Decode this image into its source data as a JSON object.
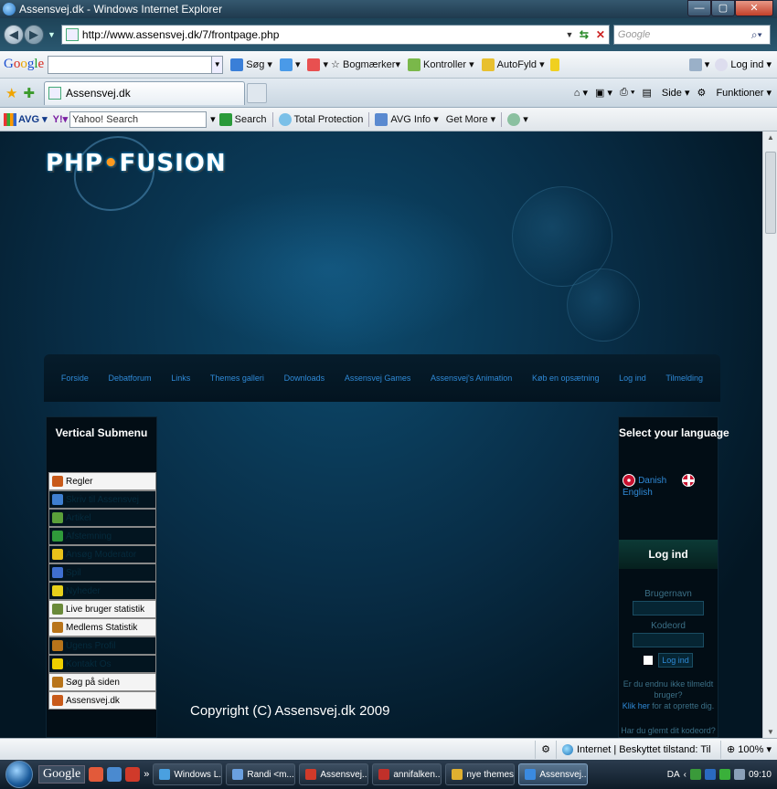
{
  "window": {
    "title": "Assensvej.dk - Windows Internet Explorer",
    "buttons": {
      "minimize": "—",
      "maximize": "▢",
      "close": "✕"
    }
  },
  "addressbar": {
    "url": "http://www.assensvej.dk/7/frontpage.php",
    "search_placeholder": "Google"
  },
  "google_toolbar": {
    "brand": "Google",
    "search_label": "Søg",
    "bookmarks_label": "Bogmærker",
    "check_label": "Kontroller",
    "autofill_label": "AutoFyld",
    "login_label": "Log ind"
  },
  "tabs": {
    "active_title": "Assensvej.dk",
    "commands": {
      "page": "Side",
      "tools": "Funktioner"
    }
  },
  "avg_toolbar": {
    "brand": "AVG",
    "yahoo_placeholder": "Yahoo! Search",
    "search_label": "Search",
    "total_protection": "Total Protection",
    "avg_info": "AVG Info",
    "get_more": "Get More"
  },
  "page": {
    "logo_text_1": "PHP",
    "logo_text_2": "FUSION",
    "nav": [
      "Forside",
      "Debatforum",
      "Links",
      "Themes galleri",
      "Downloads",
      "Assensvej Games",
      "Assensvej's Animation",
      "Køb en opsætning",
      "Log ind",
      "Tilmelding"
    ],
    "left_panel": {
      "title": "Vertical Submenu",
      "items": [
        {
          "label": "Regler",
          "style": "light",
          "icon_color": "#c85a1a"
        },
        {
          "label": "Skriv til Assensvej",
          "style": "dark",
          "icon_color": "#3f7fd0"
        },
        {
          "label": "Artikel",
          "style": "dark",
          "icon_color": "#5aa03a"
        },
        {
          "label": "Afstemning",
          "style": "dark",
          "icon_color": "#2f9a3a"
        },
        {
          "label": "Ansøg Moderator",
          "style": "dark",
          "icon_color": "#e8c21a"
        },
        {
          "label": "Spil",
          "style": "dark",
          "icon_color": "#3f6fd0"
        },
        {
          "label": "Nyheder",
          "style": "dark",
          "icon_color": "#e8d01a"
        },
        {
          "label": "Live bruger statistik",
          "style": "light",
          "icon_color": "#6a8a3a"
        },
        {
          "label": "Medlems Statistik",
          "style": "light",
          "icon_color": "#b8741a"
        },
        {
          "label": "Ugens Profil",
          "style": "dark",
          "icon_color": "#b8741a"
        },
        {
          "label": "Kontakt Os",
          "style": "dark",
          "icon_color": "#f0d000"
        },
        {
          "label": "Søg på siden",
          "style": "light",
          "icon_color": "#b8741a"
        },
        {
          "label": "Assensvej.dk",
          "style": "light",
          "icon_color": "#c85a1a"
        }
      ]
    },
    "right_panel": {
      "title": "Select your language",
      "lang_danish": "Danish",
      "lang_english": "English",
      "login_title": "Log ind",
      "username_label": "Brugernavn",
      "password_label": "Kodeord",
      "login_button": "Log ind",
      "register_text": "Er du endnu ikke tilmeldt bruger?",
      "register_link": "Klik her",
      "register_suffix": "for at oprette dig.",
      "forgot_text": "Har du glemt dit kodeord?"
    },
    "copyright": "Copyright (C) Assensvej.dk 2009"
  },
  "statusbar": {
    "zone": "Internet | Beskyttet tilstand: Til",
    "zoom": "100%"
  },
  "taskbar": {
    "google": "Google",
    "buttons": [
      {
        "label": "Windows L...",
        "color": "#4aa0e0",
        "active": false
      },
      {
        "label": "Randi <m...",
        "color": "#6aa0e0",
        "active": false
      },
      {
        "label": "Assensvej....",
        "color": "#d03a2a",
        "active": false
      },
      {
        "label": "annifalken...",
        "color": "#c0302a",
        "active": false
      },
      {
        "label": "nye themes",
        "color": "#e0b030",
        "active": false
      },
      {
        "label": "Assensvej....",
        "color": "#3a8ae0",
        "active": true
      }
    ],
    "lang": "DA",
    "time": "09:10"
  }
}
